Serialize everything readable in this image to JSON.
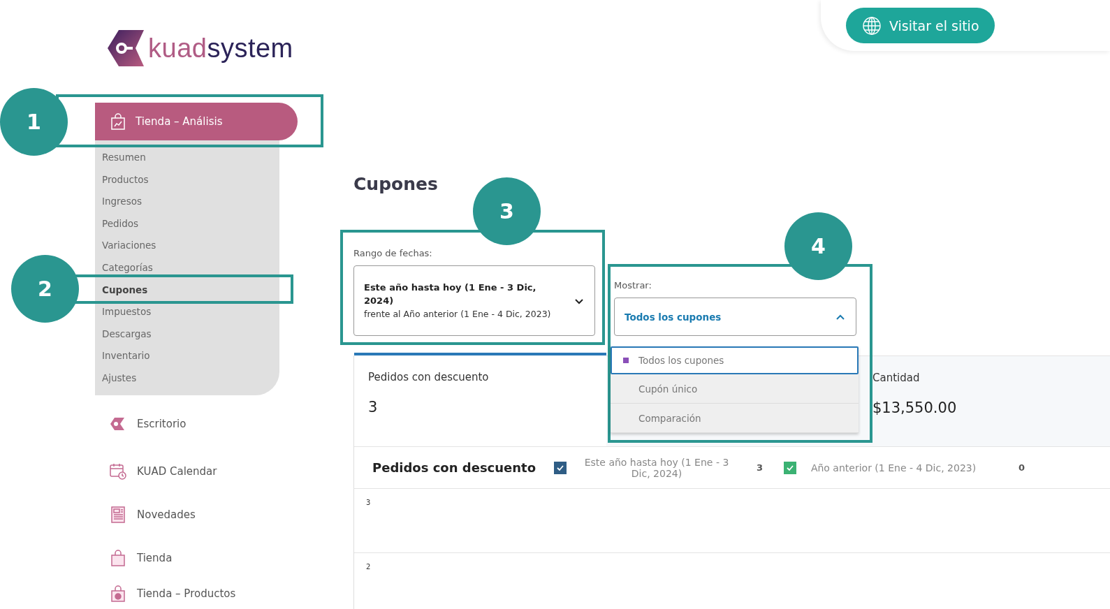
{
  "logo": {
    "brand_light": "kuad",
    "brand_dark": "system"
  },
  "header": {
    "button": "Visitar el sitio"
  },
  "sidebar": {
    "active_item": {
      "label": "Tienda – Análisis",
      "selected": true
    },
    "submenu": [
      {
        "label": "Resumen",
        "selected": false
      },
      {
        "label": "Productos",
        "selected": false
      },
      {
        "label": "Ingresos",
        "selected": false
      },
      {
        "label": "Pedidos",
        "selected": false
      },
      {
        "label": "Variaciones",
        "selected": false
      },
      {
        "label": "Categorías",
        "selected": false
      },
      {
        "label": "Cupones",
        "selected": true
      },
      {
        "label": "Impuestos",
        "selected": false
      },
      {
        "label": "Descargas",
        "selected": false
      },
      {
        "label": "Inventario",
        "selected": false
      },
      {
        "label": "Ajustes",
        "selected": false
      }
    ],
    "items": [
      {
        "label": "Escritorio",
        "kind": "logo",
        "selected": false
      },
      {
        "label": "KUAD Calendar",
        "kind": "calendar",
        "selected": false
      },
      {
        "label": "Novedades",
        "kind": "news",
        "selected": false
      },
      {
        "label": "Tienda",
        "kind": "bag",
        "selected": false
      },
      {
        "label": "Tienda – Productos",
        "kind": "bag-tag",
        "selected": false
      }
    ]
  },
  "main": {
    "title": "Cupones",
    "date_range": {
      "label": "Rango de fechas:",
      "primary": "Este año hasta hoy (1 Ene - 3 Dic, 2024)",
      "secondary": "frente al Año anterior (1 Ene - 4 Dic, 2023)"
    },
    "show_filter": {
      "label": "Mostrar:",
      "value": "Todos los cupones",
      "expanded": true,
      "options": [
        {
          "label": "Todos los cupones",
          "selected": true
        },
        {
          "label": "Cupón único",
          "selected": false
        },
        {
          "label": "Comparación",
          "selected": false
        }
      ]
    },
    "cards": [
      {
        "label": "Pedidos con descuento",
        "value": "3",
        "selected": true
      },
      {
        "label": "Cantidad",
        "value": "$13,550.00",
        "selected": false
      }
    ],
    "legend": {
      "title": "Pedidos con descuento",
      "series": [
        {
          "label": "Este año hasta hoy (1 Ene - 3 Dic, 2024)",
          "value": "3",
          "checked": true,
          "color": "#2f5d85"
        },
        {
          "label": "Año anterior (1 Ene - 4 Dic, 2023)",
          "value": "0",
          "checked": true,
          "color": "#3bb273"
        }
      ]
    },
    "chart": {
      "y_tick_labels": [
        "3",
        "2"
      ]
    }
  },
  "annotations": [
    {
      "number": "1"
    },
    {
      "number": "2"
    },
    {
      "number": "3"
    },
    {
      "number": "4"
    }
  ]
}
